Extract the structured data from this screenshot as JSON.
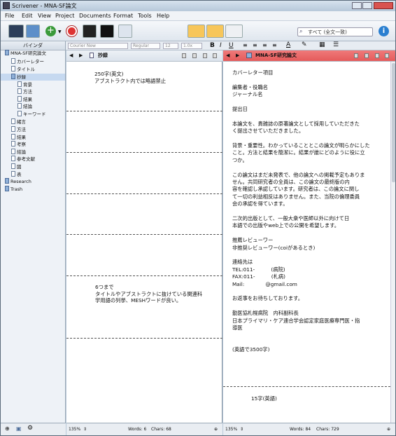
{
  "window": {
    "title": "Scrivener - MNA-SF論文"
  },
  "menu": [
    "File",
    "Edit",
    "View",
    "Project",
    "Documents",
    "Format",
    "Tools",
    "Help"
  ],
  "search": {
    "placeholder": "すべて (全文一致)"
  },
  "format": {
    "font": "Courier New",
    "style": "Regular",
    "size": "12",
    "spacing": "1.0x"
  },
  "binder": {
    "header": "バインダ",
    "items": [
      {
        "label": "MNA-SF研究論文",
        "indent": 0,
        "folder": true
      },
      {
        "label": "カバーレター",
        "indent": 1
      },
      {
        "label": "タイトル",
        "indent": 1
      },
      {
        "label": "抄録",
        "indent": 1,
        "folder": true,
        "selected": true
      },
      {
        "label": "背景",
        "indent": 2
      },
      {
        "label": "方法",
        "indent": 2
      },
      {
        "label": "結果",
        "indent": 2
      },
      {
        "label": "結論",
        "indent": 2
      },
      {
        "label": "キーワード",
        "indent": 2
      },
      {
        "label": "緒言",
        "indent": 1
      },
      {
        "label": "方法",
        "indent": 1
      },
      {
        "label": "結果",
        "indent": 1
      },
      {
        "label": "考察",
        "indent": 1
      },
      {
        "label": "結論",
        "indent": 1
      },
      {
        "label": "参考文献",
        "indent": 1
      },
      {
        "label": "図",
        "indent": 1
      },
      {
        "label": "表",
        "indent": 1
      },
      {
        "label": "Research",
        "indent": 0,
        "folder": true
      },
      {
        "label": "Trash",
        "indent": 0,
        "folder": true
      }
    ]
  },
  "left_editor": {
    "title": "抄録",
    "block1": "250字(英文)\nアブストラクト内では略語禁止",
    "block2": "6つまで\nタイトルやアブストラクトに抜けている関連科\n学用語の列挙、MESHワードが良い。",
    "zoom": "135%",
    "words": "Words: 6",
    "chars": "Chars: 68"
  },
  "right_editor": {
    "title": "MNA-SF研究論文",
    "lines": [
      "カバーレター項目",
      "",
      "編集者・役職名",
      "ジャーナル名",
      "",
      "提出日",
      "",
      "本論文を、貴雑誌の原著論文として採用していただきた",
      "く提出させていただきました。",
      "",
      "背景・重要性。わかっていることとこの論文が明らかにした",
      "こと。方法と結果を簡潔に。結果が誰にどのように役に立",
      "つか。",
      "",
      "この論文はまだ未発表で、他の論文への掲載予定もありま",
      "せん。共同研究者の全員は、この論文の最終版の内",
      "容を確認し承認しています。研究者は、この論文に関し",
      "て一切の利益相反はありません。また、当院の倫理委員",
      "会の承認を得ています。",
      "",
      "二次的出版として、一般大衆や医師以外に向けて日",
      "本語での出版やweb上での公開を希望します。",
      "",
      "推薦レビューワー",
      "非推奨レビューワー(coiがあるとき)",
      "",
      "連絡先は",
      "TEL:011-          (病院)",
      "FAX:011-          (札病)",
      "Mail:             @gmail.com",
      "",
      "お返事をお待ちしております。",
      "",
      "勤医協札幌病院　内科副科長",
      "日本プライマリ・ケア連合学会認定家庭医療専門医・指",
      "導医",
      "",
      "",
      "(英語で3500字)"
    ],
    "footer_text": "15字(英語)",
    "zoom": "135%",
    "words": "Words: 84",
    "chars": "Chars: 729"
  }
}
